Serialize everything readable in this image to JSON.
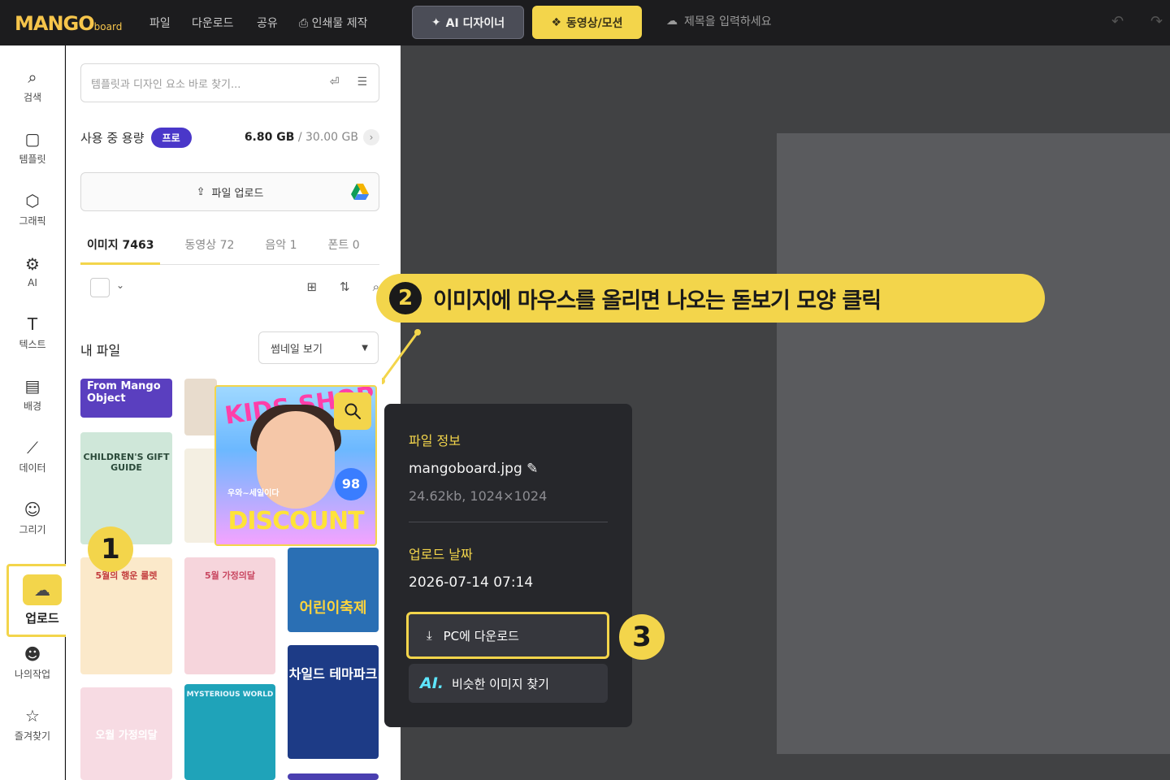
{
  "topbar": {
    "logo_main": "MANGO",
    "logo_sub": "board",
    "menu": [
      "파일",
      "다운로드",
      "공유",
      "인쇄물 제작"
    ],
    "ai_designer": "AI 디자이너",
    "video_motion": "동영상/모션",
    "title_placeholder": "제목을 입력하세요"
  },
  "rail": {
    "items": [
      {
        "label": "검색",
        "icon": "search-icon"
      },
      {
        "label": "템플릿",
        "icon": "template-icon"
      },
      {
        "label": "그래픽",
        "icon": "graphic-icon"
      },
      {
        "label": "AI",
        "icon": "ai-icon"
      },
      {
        "label": "텍스트",
        "icon": "text-icon"
      },
      {
        "label": "배경",
        "icon": "background-icon"
      },
      {
        "label": "데이터",
        "icon": "chart-icon"
      },
      {
        "label": "그리기",
        "icon": "draw-icon"
      },
      {
        "label": "업로드",
        "icon": "upload-cloud-icon"
      },
      {
        "label": "나의작업",
        "icon": "my-work-icon"
      },
      {
        "label": "즐겨찾기",
        "icon": "favorite-icon"
      }
    ]
  },
  "panel": {
    "search_placeholder": "템플릿과 디자인 요소 바로 찾기...",
    "usage_label": "사용 중 용량",
    "plan_badge": "프로",
    "used": "6.80 GB",
    "total": " / 30.00 GB",
    "upload_label": "파일 업로드",
    "tabs": [
      "이미지 7463",
      "동영상 72",
      "음악 1",
      "폰트 0"
    ],
    "myfiles": "내 파일",
    "view_mode": "썸네일 보기"
  },
  "thumbnails": [
    {
      "label": "From Mango Object"
    },
    {
      "label": "CHILDREN'S GIFT GUIDE"
    },
    {
      "label": "5월의 행운 룰렛"
    },
    {
      "label": "5월 가정의달"
    },
    {
      "label": "오월 가정의달"
    },
    {
      "label": "MYSTERIOUS WORLD"
    },
    {
      "label": "어린이축제"
    },
    {
      "label": "차일드 테마파크"
    }
  ],
  "hover_image": {
    "headline": "KIDS SHOP",
    "promo": "우와~세일이다",
    "percent": "98",
    "banner": "DISCOUNT"
  },
  "popover": {
    "info_header": "파일 정보",
    "filename": "mangoboard.jpg",
    "meta": "24.62kb, 1024×1024",
    "date_header": "업로드 날짜",
    "date": "2026-07-14 07:14",
    "download_label": "PC에 다운로드",
    "similar_tag": "AI.",
    "similar_label": "비슷한 이미지 찾기"
  },
  "callouts": {
    "step1": "1",
    "step2_num": "2",
    "step2_text": "이미지에 마우스를 올리면 나오는 돋보기 모양 클릭",
    "step3": "3"
  },
  "colors": {
    "accent": "#f3d54b",
    "badge": "#4a37c9",
    "dark": "#26272b"
  }
}
